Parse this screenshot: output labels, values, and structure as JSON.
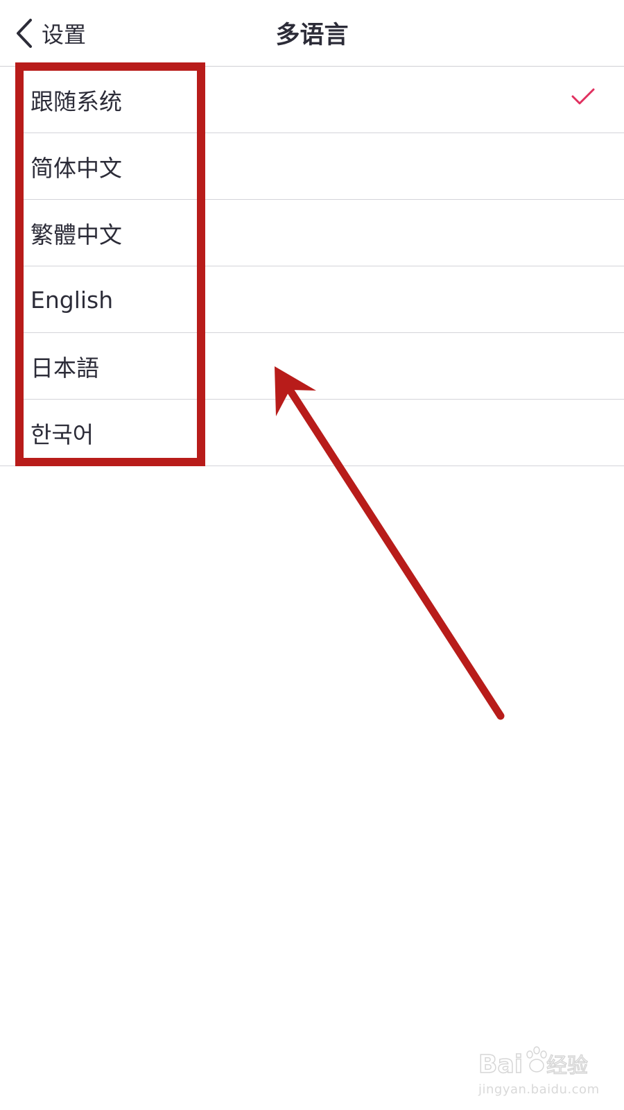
{
  "nav": {
    "back_label": "设置",
    "title": "多语言"
  },
  "languages": [
    {
      "label": "跟随系统",
      "selected": true
    },
    {
      "label": "简体中文",
      "selected": false
    },
    {
      "label": "繁體中文",
      "selected": false
    },
    {
      "label": "English",
      "selected": false
    },
    {
      "label": "日本語",
      "selected": false
    },
    {
      "label": "한국어",
      "selected": false
    }
  ],
  "icons": {
    "back": "chevron-left-icon",
    "selected": "checkmark-icon"
  },
  "colors": {
    "text": "#2c2c38",
    "check": "#e0305f",
    "annotation": "#b81c1a",
    "divider": "#d4d4d9"
  },
  "watermark": {
    "url": "jingyan.baidu.com",
    "logo": "Baidu经验"
  }
}
